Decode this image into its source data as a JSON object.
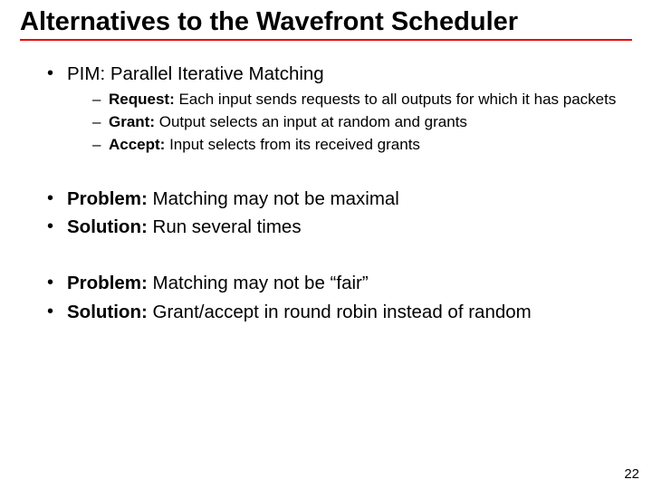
{
  "title": "Alternatives to the Wavefront Scheduler",
  "b1": {
    "text": "PIM: Parallel Iterative Matching",
    "sub": {
      "a": {
        "lead": "Request:",
        "rest": " Each input sends requests to all outputs for which it has packets"
      },
      "b": {
        "lead": "Grant:",
        "rest": " Output selects an input at random and grants"
      },
      "c": {
        "lead": "Accept:",
        "rest": " Input selects from its received grants"
      }
    }
  },
  "b2": {
    "lead": "Problem:",
    "rest": " Matching may not be maximal"
  },
  "b3": {
    "lead": "Solution:",
    "rest": " Run several times"
  },
  "b4": {
    "lead": "Problem:",
    "rest": " Matching may not be “fair”"
  },
  "b5": {
    "lead": "Solution:",
    "rest": " Grant/accept in round robin instead of random"
  },
  "page": "22"
}
